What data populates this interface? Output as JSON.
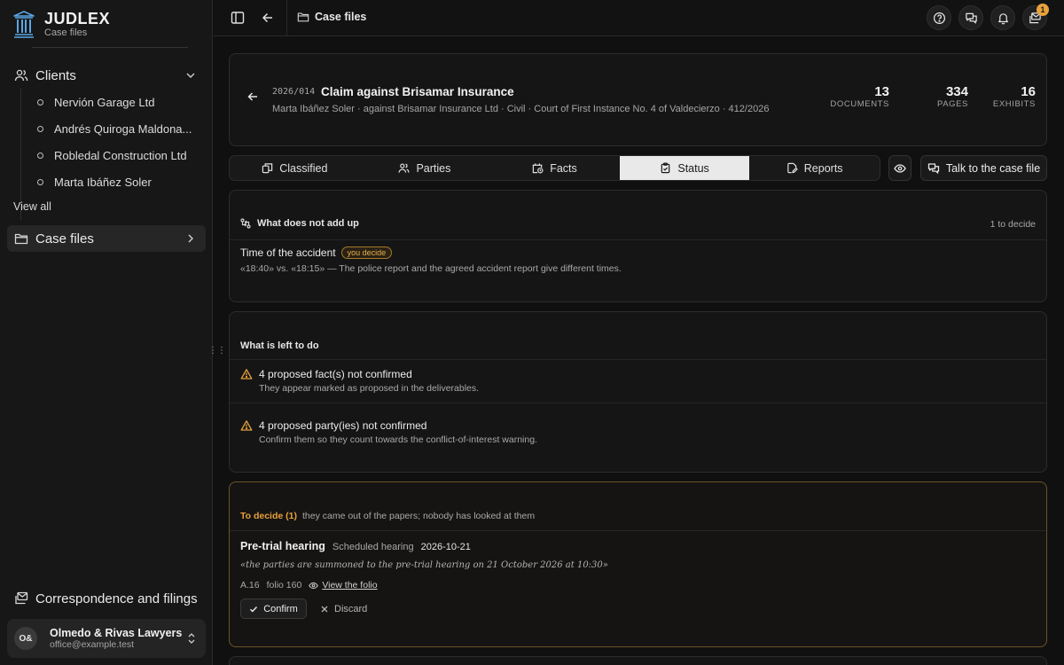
{
  "brand": {
    "name": "JUDLEX",
    "subtitle": "Case files"
  },
  "sidebar": {
    "clients_label": "Clients",
    "clients": [
      {
        "label": "Nervión Garage Ltd"
      },
      {
        "label": "Andrés Quiroga Maldona..."
      },
      {
        "label": "Robledal Construction Ltd"
      },
      {
        "label": "Marta Ibáñez Soler"
      }
    ],
    "view_all": "View all",
    "case_files_label": "Case files",
    "correspondence_label": "Correspondence and filings",
    "account": {
      "initials": "O&",
      "name": "Olmedo & Rivas Lawyers",
      "email": "office@example.test"
    }
  },
  "topbar": {
    "breadcrumb": "Case files",
    "notification_count": "1"
  },
  "case": {
    "ref": "2026/014",
    "title": "Claim against Brisamar Insurance",
    "meta": "Marta Ibáñez Soler · against Brisamar Insurance Ltd · Civil · Court of First Instance No. 4 of Valdecierzo · 412/2026",
    "stats": [
      {
        "value": "13",
        "caption": "DOCUMENTS"
      },
      {
        "value": "334",
        "caption": "PAGES"
      },
      {
        "value": "16",
        "caption": "EXHIBITS"
      }
    ]
  },
  "tabs": [
    {
      "label": "Classified",
      "icon": "layers-icon"
    },
    {
      "label": "Parties",
      "icon": "users-icon"
    },
    {
      "label": "Facts",
      "icon": "calendar-clock-icon"
    },
    {
      "label": "Status",
      "icon": "clipboard-check-icon",
      "active": true
    },
    {
      "label": "Reports",
      "icon": "file-edit-icon"
    }
  ],
  "talk_button": "Talk to the case file",
  "conflicts": {
    "heading": "What does not add up",
    "counter": "1 to decide",
    "item": {
      "title": "Time of the accident",
      "tag": "you decide",
      "desc": "«18:40» vs. «18:15» — The police report and the agreed accident report give different times."
    }
  },
  "todo": {
    "heading": "What is left to do",
    "items": [
      {
        "title": "4 proposed fact(s) not confirmed",
        "desc": "They appear marked as proposed in the deliverables."
      },
      {
        "title": "4 proposed party(ies) not confirmed",
        "desc": "Confirm them so they count towards the conflict-of-interest warning."
      }
    ]
  },
  "decide": {
    "heading": "To decide (1)",
    "subheading": "they came out of the papers; nobody has looked at them",
    "hearing": {
      "title": "Pre-trial hearing",
      "type": "Scheduled hearing",
      "date": "2026-10-21",
      "quote": "«the parties are summoned to the pre-trial hearing on 21 October 2026 at 10:30»",
      "exhibit": "A.16",
      "folio": "folio 160",
      "view_link": "View the folio"
    },
    "confirm_label": "Confirm",
    "discard_label": "Discard"
  },
  "colors": {
    "accent": "#e6a23c",
    "background": "#101010",
    "active_tab": "#e9e9e9"
  }
}
